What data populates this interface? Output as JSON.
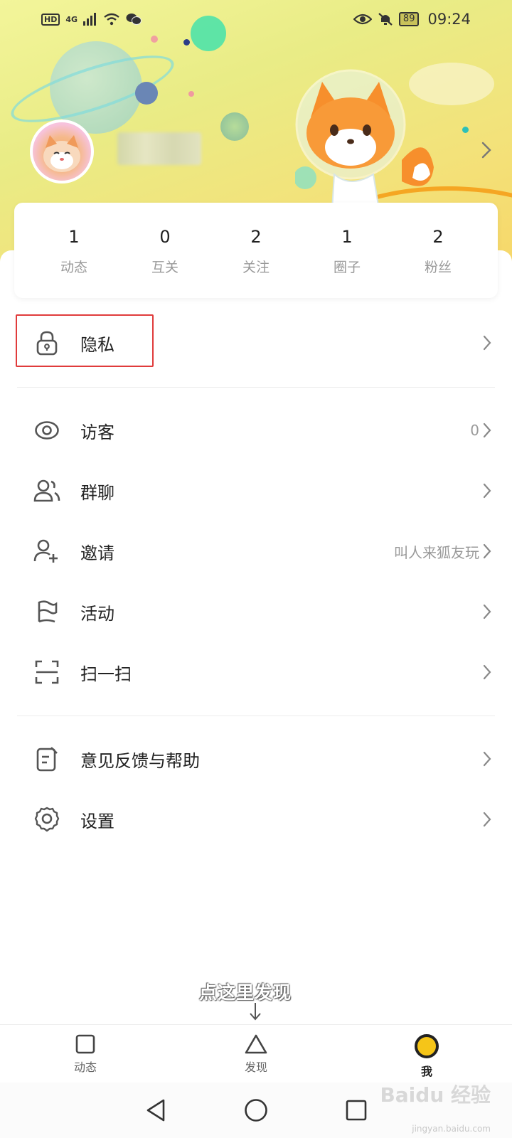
{
  "status_bar": {
    "left_badge": "HD",
    "network": "4G",
    "battery": "89",
    "time": "09:24"
  },
  "profile": {
    "stats": [
      {
        "value": "1",
        "label": "动态"
      },
      {
        "value": "0",
        "label": "互关"
      },
      {
        "value": "2",
        "label": "关注"
      },
      {
        "value": "1",
        "label": "圈子"
      },
      {
        "value": "2",
        "label": "粉丝"
      }
    ]
  },
  "menu": {
    "privacy": {
      "label": "隐私",
      "icon": "lock-icon"
    },
    "visitors": {
      "label": "访客",
      "value": "0",
      "icon": "eye-icon"
    },
    "group_chat": {
      "label": "群聊",
      "icon": "group-icon"
    },
    "invite": {
      "label": "邀请",
      "value": "叫人来狐友玩",
      "icon": "add-user-icon"
    },
    "activity": {
      "label": "活动",
      "icon": "flag-icon"
    },
    "scan": {
      "label": "扫一扫",
      "icon": "scan-icon"
    },
    "feedback": {
      "label": "意见反馈与帮助",
      "icon": "feedback-icon"
    },
    "settings": {
      "label": "设置",
      "icon": "gear-icon"
    }
  },
  "overlay": {
    "hint": "点这里发现"
  },
  "bottom_nav": {
    "items": [
      {
        "label": "动态",
        "icon": "square-icon"
      },
      {
        "label": "发现",
        "icon": "triangle-icon"
      },
      {
        "label": "我",
        "icon": "circle-icon",
        "active": true
      }
    ]
  },
  "watermark": {
    "brand": "Baidu 经验",
    "url": "jingyan.baidu.com"
  },
  "colors": {
    "accent": "#f5c518",
    "highlight_border": "#e03b3b",
    "header_bg": "#eeed8a"
  }
}
